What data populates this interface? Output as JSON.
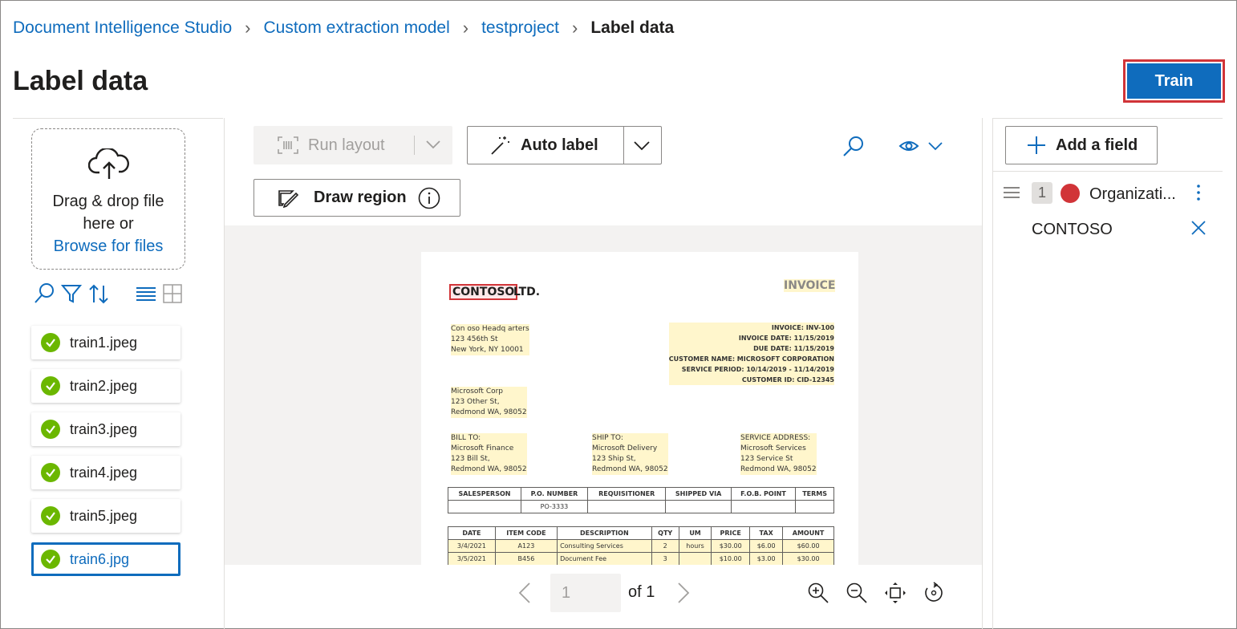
{
  "breadcrumb": {
    "items": [
      "Document Intelligence Studio",
      "Custom extraction model",
      "testproject"
    ],
    "current": "Label data"
  },
  "page": {
    "title": "Label data"
  },
  "actions": {
    "train_label": "Train"
  },
  "upload": {
    "drag_text": "Drag & drop file here or",
    "browse_link": "Browse for files"
  },
  "files": [
    {
      "name": "train1.jpeg",
      "status": "labeled"
    },
    {
      "name": "train2.jpeg",
      "status": "labeled"
    },
    {
      "name": "train3.jpeg",
      "status": "labeled"
    },
    {
      "name": "train4.jpeg",
      "status": "labeled"
    },
    {
      "name": "train5.jpeg",
      "status": "labeled"
    },
    {
      "name": "train6.jpg",
      "status": "labeled",
      "selected": true
    }
  ],
  "toolbar": {
    "run_layout": "Run layout",
    "auto_label": "Auto label",
    "draw_region": "Draw region"
  },
  "document": {
    "company": "CONTOSO",
    "company_suffix": "LTD.",
    "doc_title": "INVOICE",
    "address_block": "Con oso Headq arters\n123 456th St\nNew York, NY 10001",
    "invoice_block": "INVOICE: INV-100\nINVOICE DATE: 11/15/2019\nDUE DATE: 11/15/2019\nCUSTOMER NAME: MICROSOFT CORPORATION\nSERVICE PERIOD: 10/14/2019 - 11/14/2019\nCUSTOMER ID: CID-12345",
    "remit_block": "Microsoft Corp\n123 Other St,\nRedmond WA, 98052",
    "bill_to": "BILL TO:\nMicrosoft Finance\n123 Bill St,\nRedmond WA, 98052",
    "ship_to": "SHIP TO:\nMicrosoft Delivery\n123 Ship St,\nRedmond WA, 98052",
    "service_address": "SERVICE ADDRESS:\nMicrosoft Services\n123 Service St\nRedmond WA, 98052",
    "table1_headers": [
      "SALESPERSON",
      "P.O. NUMBER",
      "REQUISITIONER",
      "SHIPPED VIA",
      "F.O.B. POINT",
      "TERMS"
    ],
    "table1_row": [
      "",
      "PO-3333",
      "",
      "",
      "",
      ""
    ],
    "table2_headers": [
      "DATE",
      "ITEM CODE",
      "DESCRIPTION",
      "QTY",
      "UM",
      "PRICE",
      "TAX",
      "AMOUNT"
    ],
    "table2_rows": [
      [
        "3/4/2021",
        "A123",
        "Consulting Services",
        "2",
        "hours",
        "$30.00",
        "$6.00",
        "$60.00"
      ],
      [
        "3/5/2021",
        "B456",
        "Document Fee",
        "3",
        "",
        "$10.00",
        "$3.00",
        "$30.00"
      ]
    ]
  },
  "pager": {
    "current_page": "1",
    "of_label": "of 1"
  },
  "fields_panel": {
    "add_field": "Add a field",
    "fields": [
      {
        "index": "1",
        "name": "Organizati...",
        "color": "#d13438",
        "value": "CONTOSO"
      }
    ]
  },
  "colors": {
    "accent": "#0f6cbd",
    "highlight": "#d13438",
    "success": "#6bb700"
  }
}
